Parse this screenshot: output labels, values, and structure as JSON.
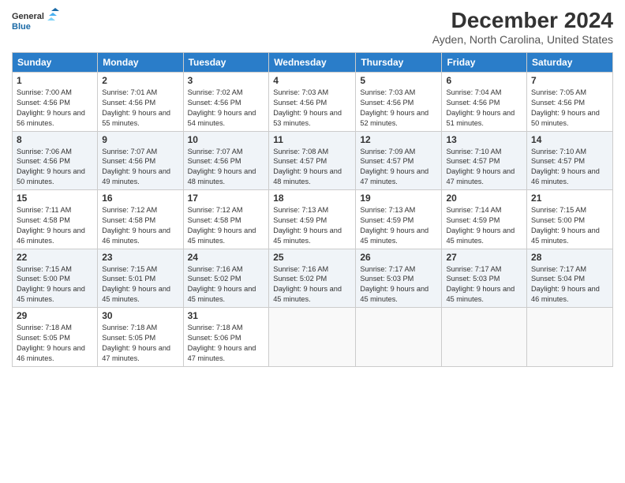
{
  "header": {
    "logo_line1": "General",
    "logo_line2": "Blue",
    "title": "December 2024",
    "subtitle": "Ayden, North Carolina, United States"
  },
  "calendar": {
    "headers": [
      "Sunday",
      "Monday",
      "Tuesday",
      "Wednesday",
      "Thursday",
      "Friday",
      "Saturday"
    ],
    "weeks": [
      [
        {
          "day": "1",
          "sunrise": "7:00 AM",
          "sunset": "4:56 PM",
          "daylight": "9 hours and 56 minutes."
        },
        {
          "day": "2",
          "sunrise": "7:01 AM",
          "sunset": "4:56 PM",
          "daylight": "9 hours and 55 minutes."
        },
        {
          "day": "3",
          "sunrise": "7:02 AM",
          "sunset": "4:56 PM",
          "daylight": "9 hours and 54 minutes."
        },
        {
          "day": "4",
          "sunrise": "7:03 AM",
          "sunset": "4:56 PM",
          "daylight": "9 hours and 53 minutes."
        },
        {
          "day": "5",
          "sunrise": "7:03 AM",
          "sunset": "4:56 PM",
          "daylight": "9 hours and 52 minutes."
        },
        {
          "day": "6",
          "sunrise": "7:04 AM",
          "sunset": "4:56 PM",
          "daylight": "9 hours and 51 minutes."
        },
        {
          "day": "7",
          "sunrise": "7:05 AM",
          "sunset": "4:56 PM",
          "daylight": "9 hours and 50 minutes."
        }
      ],
      [
        {
          "day": "8",
          "sunrise": "7:06 AM",
          "sunset": "4:56 PM",
          "daylight": "9 hours and 50 minutes."
        },
        {
          "day": "9",
          "sunrise": "7:07 AM",
          "sunset": "4:56 PM",
          "daylight": "9 hours and 49 minutes."
        },
        {
          "day": "10",
          "sunrise": "7:07 AM",
          "sunset": "4:56 PM",
          "daylight": "9 hours and 48 minutes."
        },
        {
          "day": "11",
          "sunrise": "7:08 AM",
          "sunset": "4:57 PM",
          "daylight": "9 hours and 48 minutes."
        },
        {
          "day": "12",
          "sunrise": "7:09 AM",
          "sunset": "4:57 PM",
          "daylight": "9 hours and 47 minutes."
        },
        {
          "day": "13",
          "sunrise": "7:10 AM",
          "sunset": "4:57 PM",
          "daylight": "9 hours and 47 minutes."
        },
        {
          "day": "14",
          "sunrise": "7:10 AM",
          "sunset": "4:57 PM",
          "daylight": "9 hours and 46 minutes."
        }
      ],
      [
        {
          "day": "15",
          "sunrise": "7:11 AM",
          "sunset": "4:58 PM",
          "daylight": "9 hours and 46 minutes."
        },
        {
          "day": "16",
          "sunrise": "7:12 AM",
          "sunset": "4:58 PM",
          "daylight": "9 hours and 46 minutes."
        },
        {
          "day": "17",
          "sunrise": "7:12 AM",
          "sunset": "4:58 PM",
          "daylight": "9 hours and 45 minutes."
        },
        {
          "day": "18",
          "sunrise": "7:13 AM",
          "sunset": "4:59 PM",
          "daylight": "9 hours and 45 minutes."
        },
        {
          "day": "19",
          "sunrise": "7:13 AM",
          "sunset": "4:59 PM",
          "daylight": "9 hours and 45 minutes."
        },
        {
          "day": "20",
          "sunrise": "7:14 AM",
          "sunset": "4:59 PM",
          "daylight": "9 hours and 45 minutes."
        },
        {
          "day": "21",
          "sunrise": "7:15 AM",
          "sunset": "5:00 PM",
          "daylight": "9 hours and 45 minutes."
        }
      ],
      [
        {
          "day": "22",
          "sunrise": "7:15 AM",
          "sunset": "5:00 PM",
          "daylight": "9 hours and 45 minutes."
        },
        {
          "day": "23",
          "sunrise": "7:15 AM",
          "sunset": "5:01 PM",
          "daylight": "9 hours and 45 minutes."
        },
        {
          "day": "24",
          "sunrise": "7:16 AM",
          "sunset": "5:02 PM",
          "daylight": "9 hours and 45 minutes."
        },
        {
          "day": "25",
          "sunrise": "7:16 AM",
          "sunset": "5:02 PM",
          "daylight": "9 hours and 45 minutes."
        },
        {
          "day": "26",
          "sunrise": "7:17 AM",
          "sunset": "5:03 PM",
          "daylight": "9 hours and 45 minutes."
        },
        {
          "day": "27",
          "sunrise": "7:17 AM",
          "sunset": "5:03 PM",
          "daylight": "9 hours and 45 minutes."
        },
        {
          "day": "28",
          "sunrise": "7:17 AM",
          "sunset": "5:04 PM",
          "daylight": "9 hours and 46 minutes."
        }
      ],
      [
        {
          "day": "29",
          "sunrise": "7:18 AM",
          "sunset": "5:05 PM",
          "daylight": "9 hours and 46 minutes."
        },
        {
          "day": "30",
          "sunrise": "7:18 AM",
          "sunset": "5:05 PM",
          "daylight": "9 hours and 47 minutes."
        },
        {
          "day": "31",
          "sunrise": "7:18 AM",
          "sunset": "5:06 PM",
          "daylight": "9 hours and 47 minutes."
        },
        null,
        null,
        null,
        null
      ]
    ]
  }
}
